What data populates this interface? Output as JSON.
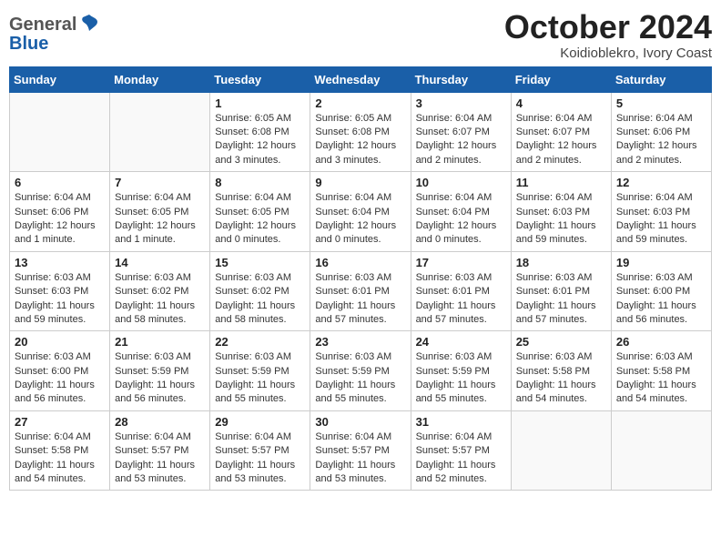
{
  "header": {
    "logo_general": "General",
    "logo_blue": "Blue",
    "title": "October 2024",
    "location": "Koidioblekro, Ivory Coast"
  },
  "calendar": {
    "days_of_week": [
      "Sunday",
      "Monday",
      "Tuesday",
      "Wednesday",
      "Thursday",
      "Friday",
      "Saturday"
    ],
    "weeks": [
      [
        {
          "day": "",
          "info": ""
        },
        {
          "day": "",
          "info": ""
        },
        {
          "day": "1",
          "info": "Sunrise: 6:05 AM\nSunset: 6:08 PM\nDaylight: 12 hours\nand 3 minutes."
        },
        {
          "day": "2",
          "info": "Sunrise: 6:05 AM\nSunset: 6:08 PM\nDaylight: 12 hours\nand 3 minutes."
        },
        {
          "day": "3",
          "info": "Sunrise: 6:04 AM\nSunset: 6:07 PM\nDaylight: 12 hours\nand 2 minutes."
        },
        {
          "day": "4",
          "info": "Sunrise: 6:04 AM\nSunset: 6:07 PM\nDaylight: 12 hours\nand 2 minutes."
        },
        {
          "day": "5",
          "info": "Sunrise: 6:04 AM\nSunset: 6:06 PM\nDaylight: 12 hours\nand 2 minutes."
        }
      ],
      [
        {
          "day": "6",
          "info": "Sunrise: 6:04 AM\nSunset: 6:06 PM\nDaylight: 12 hours\nand 1 minute."
        },
        {
          "day": "7",
          "info": "Sunrise: 6:04 AM\nSunset: 6:05 PM\nDaylight: 12 hours\nand 1 minute."
        },
        {
          "day": "8",
          "info": "Sunrise: 6:04 AM\nSunset: 6:05 PM\nDaylight: 12 hours\nand 0 minutes."
        },
        {
          "day": "9",
          "info": "Sunrise: 6:04 AM\nSunset: 6:04 PM\nDaylight: 12 hours\nand 0 minutes."
        },
        {
          "day": "10",
          "info": "Sunrise: 6:04 AM\nSunset: 6:04 PM\nDaylight: 12 hours\nand 0 minutes."
        },
        {
          "day": "11",
          "info": "Sunrise: 6:04 AM\nSunset: 6:03 PM\nDaylight: 11 hours\nand 59 minutes."
        },
        {
          "day": "12",
          "info": "Sunrise: 6:04 AM\nSunset: 6:03 PM\nDaylight: 11 hours\nand 59 minutes."
        }
      ],
      [
        {
          "day": "13",
          "info": "Sunrise: 6:03 AM\nSunset: 6:03 PM\nDaylight: 11 hours\nand 59 minutes."
        },
        {
          "day": "14",
          "info": "Sunrise: 6:03 AM\nSunset: 6:02 PM\nDaylight: 11 hours\nand 58 minutes."
        },
        {
          "day": "15",
          "info": "Sunrise: 6:03 AM\nSunset: 6:02 PM\nDaylight: 11 hours\nand 58 minutes."
        },
        {
          "day": "16",
          "info": "Sunrise: 6:03 AM\nSunset: 6:01 PM\nDaylight: 11 hours\nand 57 minutes."
        },
        {
          "day": "17",
          "info": "Sunrise: 6:03 AM\nSunset: 6:01 PM\nDaylight: 11 hours\nand 57 minutes."
        },
        {
          "day": "18",
          "info": "Sunrise: 6:03 AM\nSunset: 6:01 PM\nDaylight: 11 hours\nand 57 minutes."
        },
        {
          "day": "19",
          "info": "Sunrise: 6:03 AM\nSunset: 6:00 PM\nDaylight: 11 hours\nand 56 minutes."
        }
      ],
      [
        {
          "day": "20",
          "info": "Sunrise: 6:03 AM\nSunset: 6:00 PM\nDaylight: 11 hours\nand 56 minutes."
        },
        {
          "day": "21",
          "info": "Sunrise: 6:03 AM\nSunset: 5:59 PM\nDaylight: 11 hours\nand 56 minutes."
        },
        {
          "day": "22",
          "info": "Sunrise: 6:03 AM\nSunset: 5:59 PM\nDaylight: 11 hours\nand 55 minutes."
        },
        {
          "day": "23",
          "info": "Sunrise: 6:03 AM\nSunset: 5:59 PM\nDaylight: 11 hours\nand 55 minutes."
        },
        {
          "day": "24",
          "info": "Sunrise: 6:03 AM\nSunset: 5:59 PM\nDaylight: 11 hours\nand 55 minutes."
        },
        {
          "day": "25",
          "info": "Sunrise: 6:03 AM\nSunset: 5:58 PM\nDaylight: 11 hours\nand 54 minutes."
        },
        {
          "day": "26",
          "info": "Sunrise: 6:03 AM\nSunset: 5:58 PM\nDaylight: 11 hours\nand 54 minutes."
        }
      ],
      [
        {
          "day": "27",
          "info": "Sunrise: 6:04 AM\nSunset: 5:58 PM\nDaylight: 11 hours\nand 54 minutes."
        },
        {
          "day": "28",
          "info": "Sunrise: 6:04 AM\nSunset: 5:57 PM\nDaylight: 11 hours\nand 53 minutes."
        },
        {
          "day": "29",
          "info": "Sunrise: 6:04 AM\nSunset: 5:57 PM\nDaylight: 11 hours\nand 53 minutes."
        },
        {
          "day": "30",
          "info": "Sunrise: 6:04 AM\nSunset: 5:57 PM\nDaylight: 11 hours\nand 53 minutes."
        },
        {
          "day": "31",
          "info": "Sunrise: 6:04 AM\nSunset: 5:57 PM\nDaylight: 11 hours\nand 52 minutes."
        },
        {
          "day": "",
          "info": ""
        },
        {
          "day": "",
          "info": ""
        }
      ]
    ]
  }
}
